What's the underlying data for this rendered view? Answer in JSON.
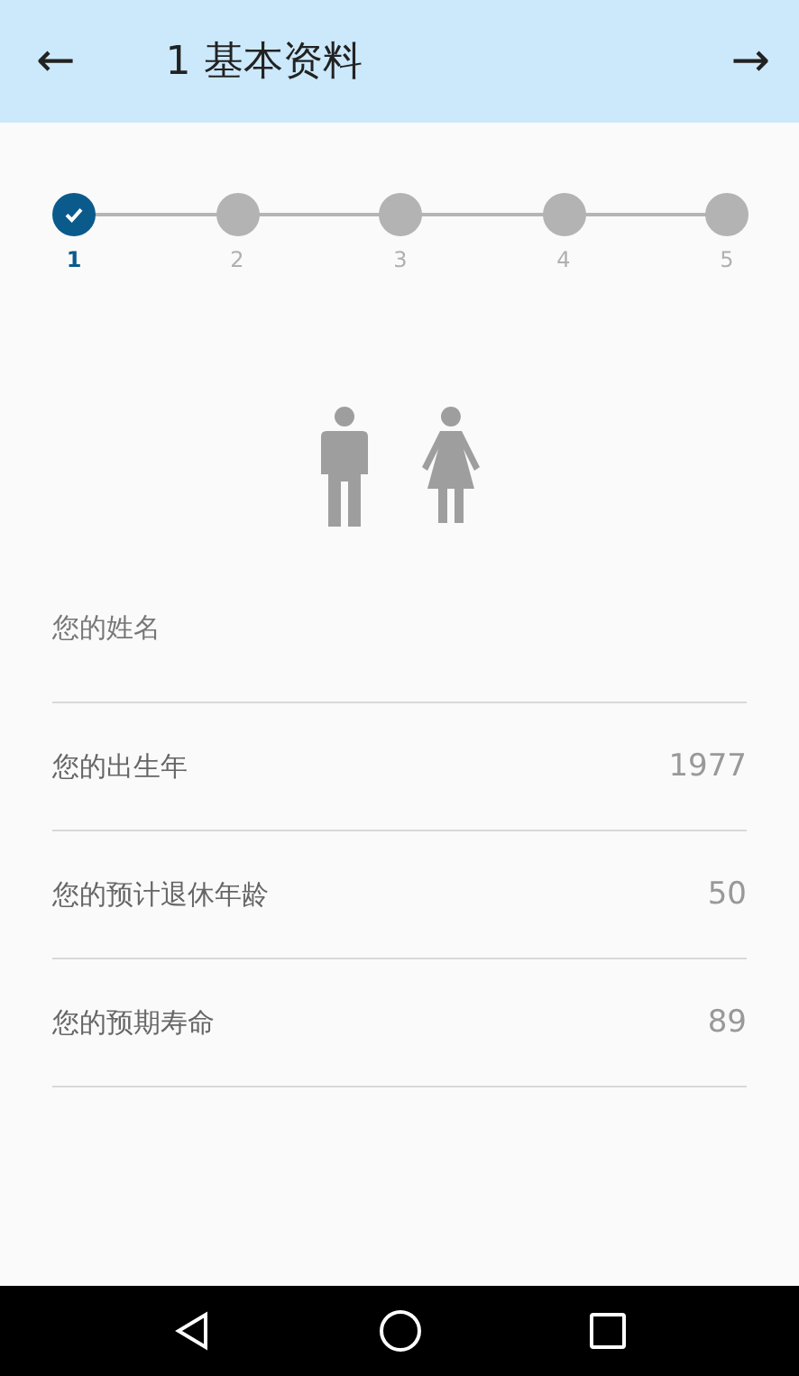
{
  "header": {
    "back": "←",
    "title": "1 基本资料",
    "forward": "→"
  },
  "steps": [
    {
      "label": "1",
      "selected": true
    },
    {
      "label": "2",
      "selected": false
    },
    {
      "label": "3",
      "selected": false
    },
    {
      "label": "4",
      "selected": false
    },
    {
      "label": "5",
      "selected": false
    }
  ],
  "fields": [
    {
      "kind": "text",
      "placeholder": "您的姓名"
    },
    {
      "kind": "number",
      "label": "您的出生年",
      "value": "1977"
    },
    {
      "kind": "number",
      "label": "您的预计退休年龄",
      "value": "50"
    },
    {
      "kind": "number",
      "label": "您的预期寿命",
      "value": "89"
    }
  ]
}
